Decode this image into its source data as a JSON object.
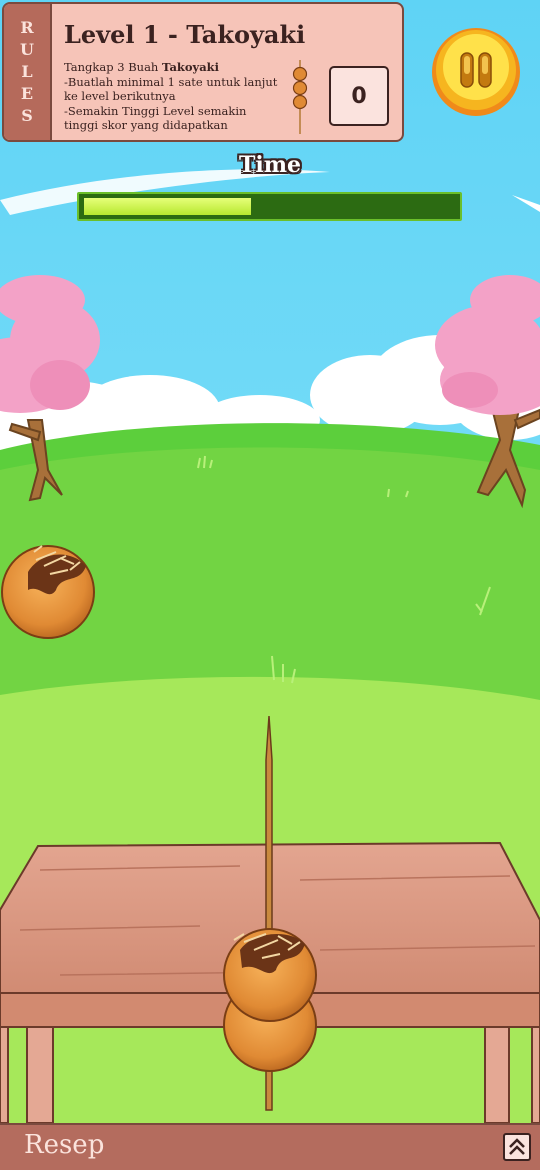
{
  "rules": {
    "tab_letters": [
      "R",
      "U",
      "L",
      "E",
      "S"
    ],
    "title": "Level 1 - Takoyaki",
    "line1_prefix": "Tangkap 3 Buah ",
    "line1_bold": "Takoyaki",
    "line2": "-Buatlah minimal 1 sate untuk lanjut ke level berikutnya",
    "line3": "-Semakin Tinggi Level semakin tinggi skor yang didapatkan"
  },
  "score": "0",
  "time": {
    "label": "Time",
    "progress": 0.45
  },
  "bottom_bar": {
    "label": "Resep",
    "expand_icon": "double-chevron-up-icon"
  },
  "icons": {
    "pause": "pause-icon",
    "skewer": "skewer-icon"
  },
  "colors": {
    "sky": "#6ad8f6",
    "panel": "#f6c4b8",
    "panel_border": "#7a4a3e",
    "timer_fill": "#d4f55a",
    "pause_gold": "#f5c518"
  }
}
